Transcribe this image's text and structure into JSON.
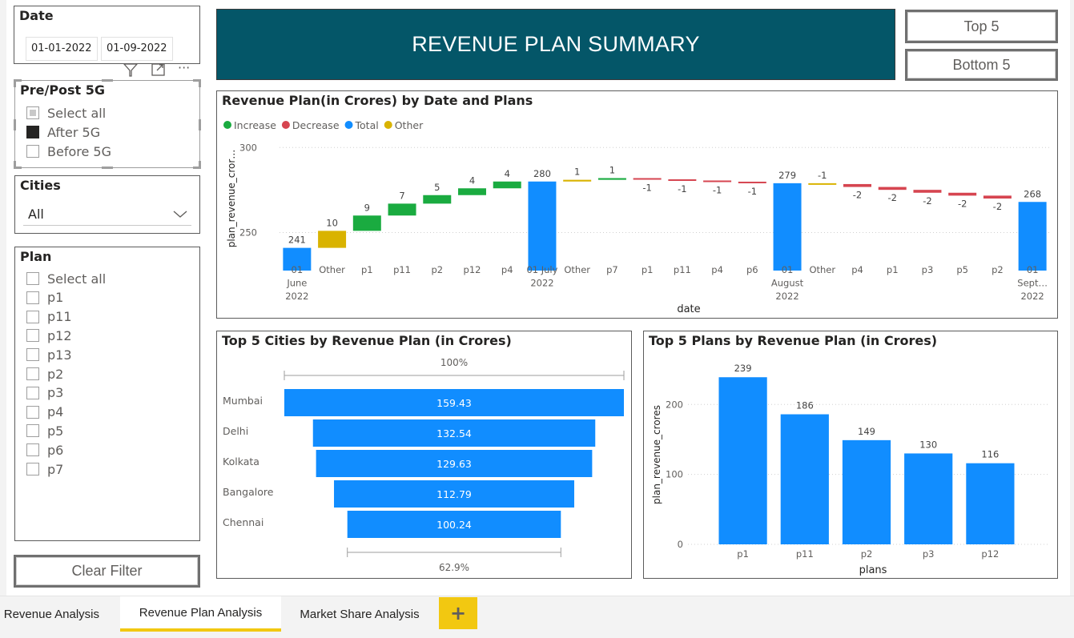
{
  "date_slicer": {
    "title": "Date",
    "start": "01-01-2022",
    "end": "01-09-2022"
  },
  "visual_toolbar": {
    "icons": [
      "filter-icon",
      "focus-mode-icon",
      "more-options-icon"
    ],
    "more_label": "···"
  },
  "prepost_slicer": {
    "title": "Pre/Post 5G",
    "items": [
      {
        "label": "Select all",
        "state": "partial"
      },
      {
        "label": "After 5G",
        "state": "checked"
      },
      {
        "label": "Before 5G",
        "state": "unchecked"
      }
    ]
  },
  "cities_slicer": {
    "title": "Cities",
    "value": "All"
  },
  "plan_slicer": {
    "title": "Plan",
    "items": [
      "Select all",
      "p1",
      "p11",
      "p12",
      "p13",
      "p2",
      "p3",
      "p4",
      "p5",
      "p6",
      "p7"
    ]
  },
  "clear_filter": {
    "label": "Clear Filter"
  },
  "header": {
    "title": "REVENUE PLAN SUMMARY",
    "bg": "#045668"
  },
  "buttons": {
    "top5": "Top 5",
    "bottom5": "Bottom 5"
  },
  "colors": {
    "increase": "#1aab40",
    "decrease": "#d64550",
    "total": "#118dff",
    "other": "#d9b300",
    "bar": "#118dff",
    "accent_tab": "#f2c811"
  },
  "chart_data": [
    {
      "type": "waterfall",
      "title": "Revenue Plan(in Crores) by Date and Plans",
      "legend": [
        {
          "name": "Increase",
          "color": "#1aab40"
        },
        {
          "name": "Decrease",
          "color": "#d64550"
        },
        {
          "name": "Total",
          "color": "#118dff"
        },
        {
          "name": "Other",
          "color": "#d9b300"
        }
      ],
      "xlabel": "date",
      "ylabel": "plan_revenue_cror…",
      "yticks": [
        250,
        300
      ],
      "ylim": [
        238,
        302
      ],
      "bars": [
        {
          "cat": [
            "01",
            "June",
            "2022"
          ],
          "kind": "total",
          "start": 0,
          "end": 241,
          "label": "241"
        },
        {
          "cat": [
            "Other"
          ],
          "kind": "other",
          "start": 241,
          "end": 251,
          "label": "10"
        },
        {
          "cat": [
            "p1"
          ],
          "kind": "increase",
          "start": 251,
          "end": 260,
          "label": "9"
        },
        {
          "cat": [
            "p11"
          ],
          "kind": "increase",
          "start": 260,
          "end": 267,
          "label": "7"
        },
        {
          "cat": [
            "p2"
          ],
          "kind": "increase",
          "start": 267,
          "end": 272,
          "label": "5"
        },
        {
          "cat": [
            "p12"
          ],
          "kind": "increase",
          "start": 272,
          "end": 276,
          "label": "4"
        },
        {
          "cat": [
            "p4"
          ],
          "kind": "increase",
          "start": 276,
          "end": 280,
          "label": "4"
        },
        {
          "cat": [
            "01 July",
            "2022"
          ],
          "kind": "total",
          "start": 0,
          "end": 280,
          "label": "280"
        },
        {
          "cat": [
            "Other"
          ],
          "kind": "other",
          "start": 280,
          "end": 281,
          "label": "1"
        },
        {
          "cat": [
            "p7"
          ],
          "kind": "increase",
          "start": 281,
          "end": 282,
          "label": "1"
        },
        {
          "cat": [
            "p1"
          ],
          "kind": "decrease",
          "start": 282,
          "end": 281.3,
          "label": "-1"
        },
        {
          "cat": [
            "p11"
          ],
          "kind": "decrease",
          "start": 281.3,
          "end": 280.6,
          "label": "-1"
        },
        {
          "cat": [
            "p4"
          ],
          "kind": "decrease",
          "start": 280.6,
          "end": 279.9,
          "label": "-1"
        },
        {
          "cat": [
            "p6"
          ],
          "kind": "decrease",
          "start": 279.9,
          "end": 279.2,
          "label": "-1"
        },
        {
          "cat": [
            "01",
            "August",
            "2022"
          ],
          "kind": "total",
          "start": 0,
          "end": 279,
          "label": "279"
        },
        {
          "cat": [
            "Other"
          ],
          "kind": "other",
          "start": 279,
          "end": 278.5,
          "label": "-1"
        },
        {
          "cat": [
            "p4"
          ],
          "kind": "decrease",
          "start": 278.5,
          "end": 276.8,
          "label": "-2"
        },
        {
          "cat": [
            "p1"
          ],
          "kind": "decrease",
          "start": 276.8,
          "end": 275.1,
          "label": "-2"
        },
        {
          "cat": [
            "p3"
          ],
          "kind": "decrease",
          "start": 275.1,
          "end": 273.4,
          "label": "-2"
        },
        {
          "cat": [
            "p5"
          ],
          "kind": "decrease",
          "start": 273.4,
          "end": 271.7,
          "label": "-2"
        },
        {
          "cat": [
            "p2"
          ],
          "kind": "decrease",
          "start": 271.7,
          "end": 270,
          "label": "-2"
        },
        {
          "cat": [
            "01",
            "Sept…",
            "2022"
          ],
          "kind": "total",
          "start": 0,
          "end": 268,
          "label": "268"
        }
      ]
    },
    {
      "type": "funnel",
      "title": "Top 5 Cities by Revenue Plan (in Crores)",
      "categories": [
        "Mumbai",
        "Delhi",
        "Kolkata",
        "Bangalore",
        "Chennai"
      ],
      "values": [
        159.43,
        132.54,
        129.63,
        112.79,
        100.24
      ],
      "labels": [
        "159.43",
        "132.54",
        "129.63",
        "112.79",
        "100.24"
      ],
      "top_pct": "100%",
      "bottom_pct": "62.9%"
    },
    {
      "type": "bar",
      "title": "Top 5 Plans by Revenue Plan (in Crores)",
      "categories": [
        "p1",
        "p11",
        "p2",
        "p3",
        "p12"
      ],
      "values": [
        239,
        186,
        149,
        130,
        116
      ],
      "labels": [
        "239",
        "186",
        "149",
        "130",
        "116"
      ],
      "xlabel": "plans",
      "ylabel": "plan_revenue_crores",
      "yticks": [
        0,
        100,
        200
      ],
      "ylim": [
        0,
        245
      ]
    }
  ],
  "tabs": [
    {
      "label": "o Revenue Analysis",
      "active": false
    },
    {
      "label": "Revenue Plan Analysis",
      "active": true
    },
    {
      "label": "Market Share Analysis",
      "active": false
    }
  ],
  "add_tab": {
    "label": "+"
  }
}
